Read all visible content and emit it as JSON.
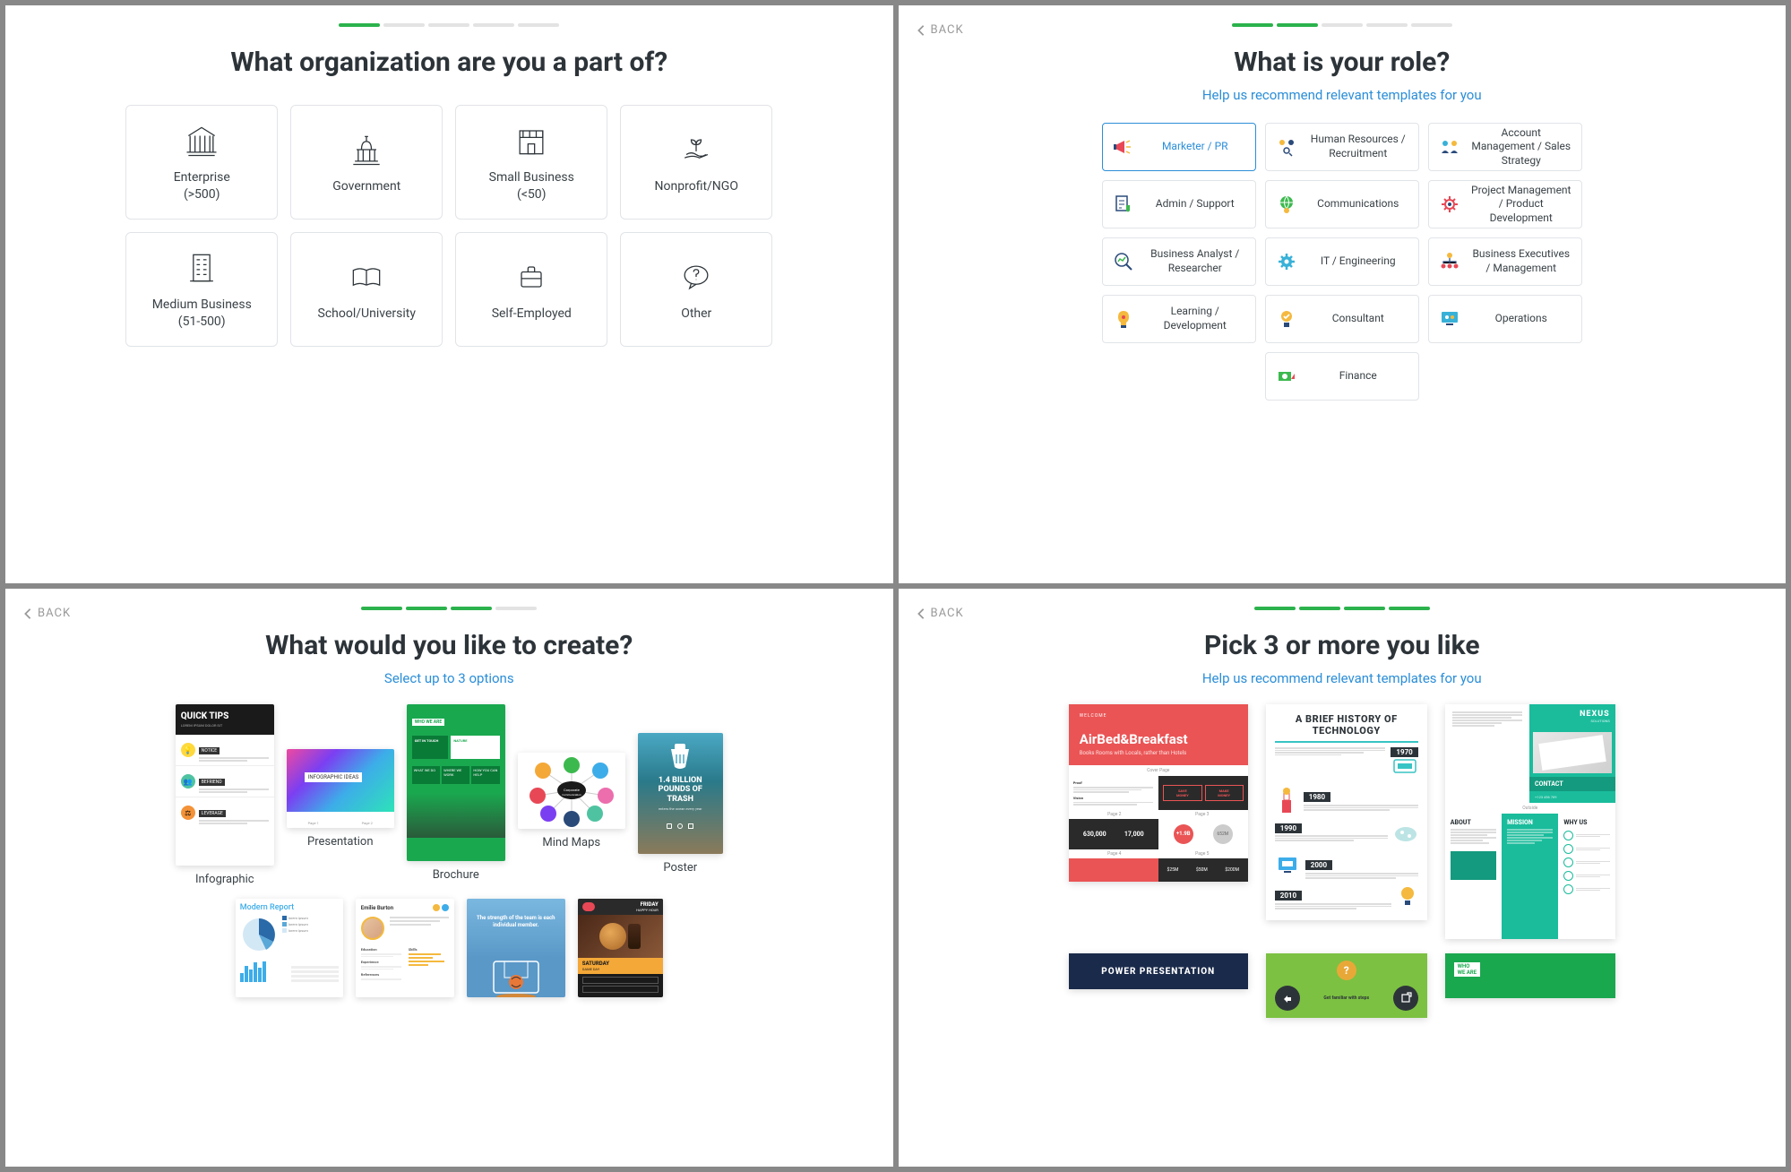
{
  "back_label": "BACK",
  "panel1": {
    "title": "What organization are you a part of?",
    "progress_active": 1,
    "progress_total": 5,
    "cards": [
      {
        "label": "Enterprise\n(>500)"
      },
      {
        "label": "Government"
      },
      {
        "label": "Small Business\n(<50)"
      },
      {
        "label": "Nonprofit/NGO"
      },
      {
        "label": "Medium Business\n(51-500)"
      },
      {
        "label": "School/University"
      },
      {
        "label": "Self-Employed"
      },
      {
        "label": "Other"
      }
    ]
  },
  "panel2": {
    "title": "What is your role?",
    "subtitle": "Help us recommend relevant templates for you",
    "progress_active": 2,
    "progress_total": 5,
    "roles": [
      {
        "label": "Marketer / PR",
        "selected": true
      },
      {
        "label": "Human Resources / Recruitment"
      },
      {
        "label": "Account Management / Sales Strategy"
      },
      {
        "label": "Admin / Support"
      },
      {
        "label": "Communications"
      },
      {
        "label": "Project Management / Product Development"
      },
      {
        "label": "Business Analyst / Researcher"
      },
      {
        "label": "IT / Engineering"
      },
      {
        "label": "Business Executives / Management"
      },
      {
        "label": "Learning / Development"
      },
      {
        "label": "Consultant"
      },
      {
        "label": "Operations"
      },
      {
        "label": "Finance"
      }
    ]
  },
  "panel3": {
    "title": "What would you like to create?",
    "subtitle": "Select up to 3 options",
    "progress_active": 3,
    "progress_total": 4,
    "templates": [
      {
        "label": "Infographic"
      },
      {
        "label": "Presentation"
      },
      {
        "label": "Brochure"
      },
      {
        "label": "Mind Maps"
      },
      {
        "label": "Poster"
      }
    ]
  },
  "panel4": {
    "title": "Pick 3 or more you like",
    "subtitle": "Help us recommend relevant templates for you",
    "progress_active": 4,
    "progress_total": 4
  }
}
